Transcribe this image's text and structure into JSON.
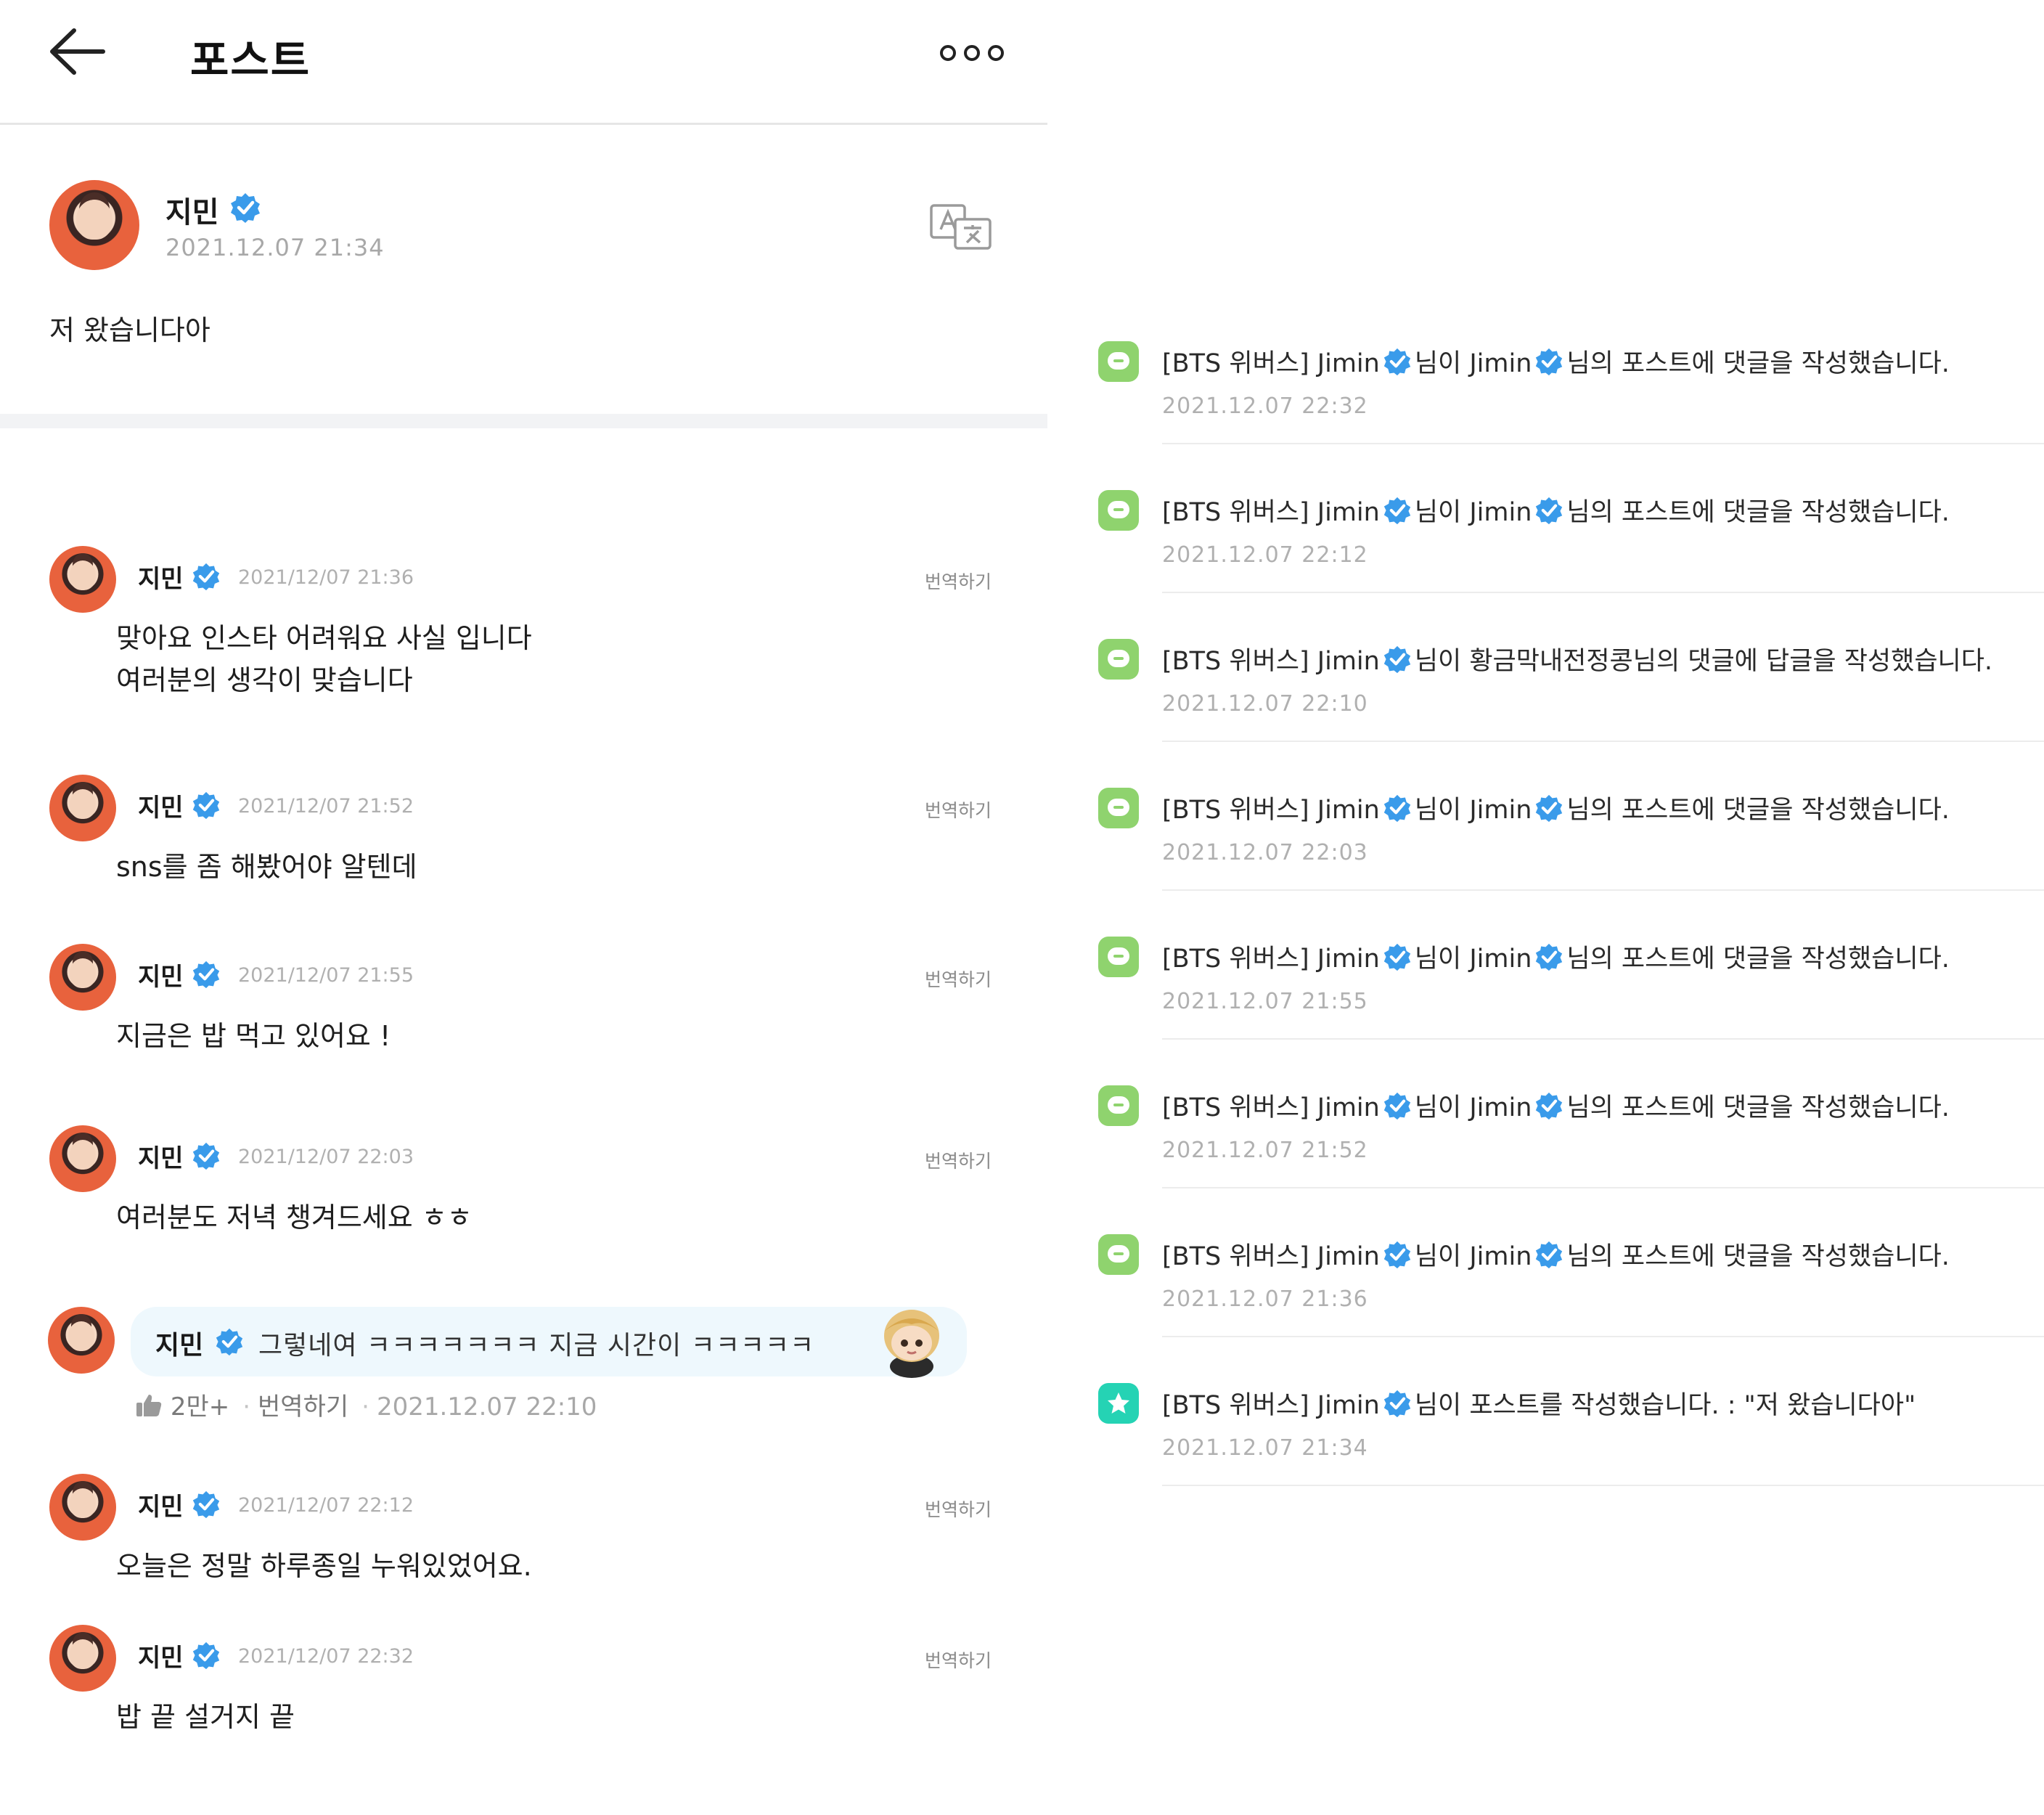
{
  "header": {
    "title": "포스트"
  },
  "post": {
    "author": "지민",
    "date": "2021.12.07 21:34",
    "body": "저 왔습니다아"
  },
  "comments": [
    {
      "author": "지민",
      "date": "2021/12/07 21:36",
      "translate": "번역하기",
      "text": "맞아요 인스타 어려워요 사실 입니다\n여러분의 생각이 맞습니다"
    },
    {
      "author": "지민",
      "date": "2021/12/07 21:52",
      "translate": "번역하기",
      "text": "sns를 좀 해봤어야 알텐데"
    },
    {
      "author": "지민",
      "date": "2021/12/07 21:55",
      "translate": "번역하기",
      "text": "지금은 밥 먹고 있어요 !"
    },
    {
      "author": "지민",
      "date": "2021/12/07 22:03",
      "translate": "번역하기",
      "text": "여러분도 저녁 챙겨드세요 ㅎㅎ"
    },
    {
      "author": "지민",
      "date": "2021/12/07 22:12",
      "translate": "번역하기",
      "text": "오늘은 정말 하루종일 누워있었어요."
    },
    {
      "author": "지민",
      "date": "2021/12/07 22:32",
      "translate": "번역하기",
      "text": "밥 끝 설거지 끝"
    }
  ],
  "reply": {
    "author": "지민",
    "text": "그렇네여 ㅋㅋㅋㅋㅋㅋㅋ 지금 시간이 ㅋㅋㅋㅋㅋ",
    "likes": "2만+",
    "translate": "번역하기",
    "date": "2021.12.07 22:10"
  },
  "notifications": [
    {
      "type": "comment",
      "p1": "[BTS 위버스] Jimin",
      "p2": "님이 Jimin",
      "p3": "님의 포스트에 댓글을 작성했습니다.",
      "time": "2021.12.07 22:32"
    },
    {
      "type": "comment",
      "p1": "[BTS 위버스] Jimin",
      "p2": "님이 Jimin",
      "p3": "님의 포스트에 댓글을 작성했습니다.",
      "time": "2021.12.07 22:12"
    },
    {
      "type": "comment",
      "p1": "[BTS 위버스] Jimin",
      "p2": "님이 황금막내전정콩님의 댓글에 답글을 작성했습니다.",
      "p3": "",
      "time": "2021.12.07 22:10"
    },
    {
      "type": "comment",
      "p1": "[BTS 위버스] Jimin",
      "p2": "님이 Jimin",
      "p3": "님의 포스트에 댓글을 작성했습니다.",
      "time": "2021.12.07 22:03"
    },
    {
      "type": "comment",
      "p1": "[BTS 위버스] Jimin",
      "p2": "님이 Jimin",
      "p3": "님의 포스트에 댓글을 작성했습니다.",
      "time": "2021.12.07 21:55"
    },
    {
      "type": "comment",
      "p1": "[BTS 위버스] Jimin",
      "p2": "님이 Jimin",
      "p3": "님의 포스트에 댓글을 작성했습니다.",
      "time": "2021.12.07 21:52"
    },
    {
      "type": "comment",
      "p1": "[BTS 위버스] Jimin",
      "p2": "님이 Jimin",
      "p3": "님의 포스트에 댓글을 작성했습니다.",
      "time": "2021.12.07 21:36"
    },
    {
      "type": "post",
      "p1": "[BTS 위버스] Jimin",
      "p2": "님이 포스트를 작성했습니다. : \"저 왔습니다아\"",
      "p3": "",
      "time": "2021.12.07 21:34"
    }
  ],
  "icons": {
    "back": "arrow-left-icon",
    "more": "more-dots-icon",
    "translate": "translate-icon",
    "verified": "verified-badge-icon",
    "like": "thumbs-up-icon",
    "notif_comment": "comment-icon",
    "notif_post": "star-icon"
  },
  "colors": {
    "verified": "#3a9bea",
    "comment_icon": "#8fd36e",
    "post_icon": "#25d3b4",
    "reply_bg": "#eef8fd"
  }
}
